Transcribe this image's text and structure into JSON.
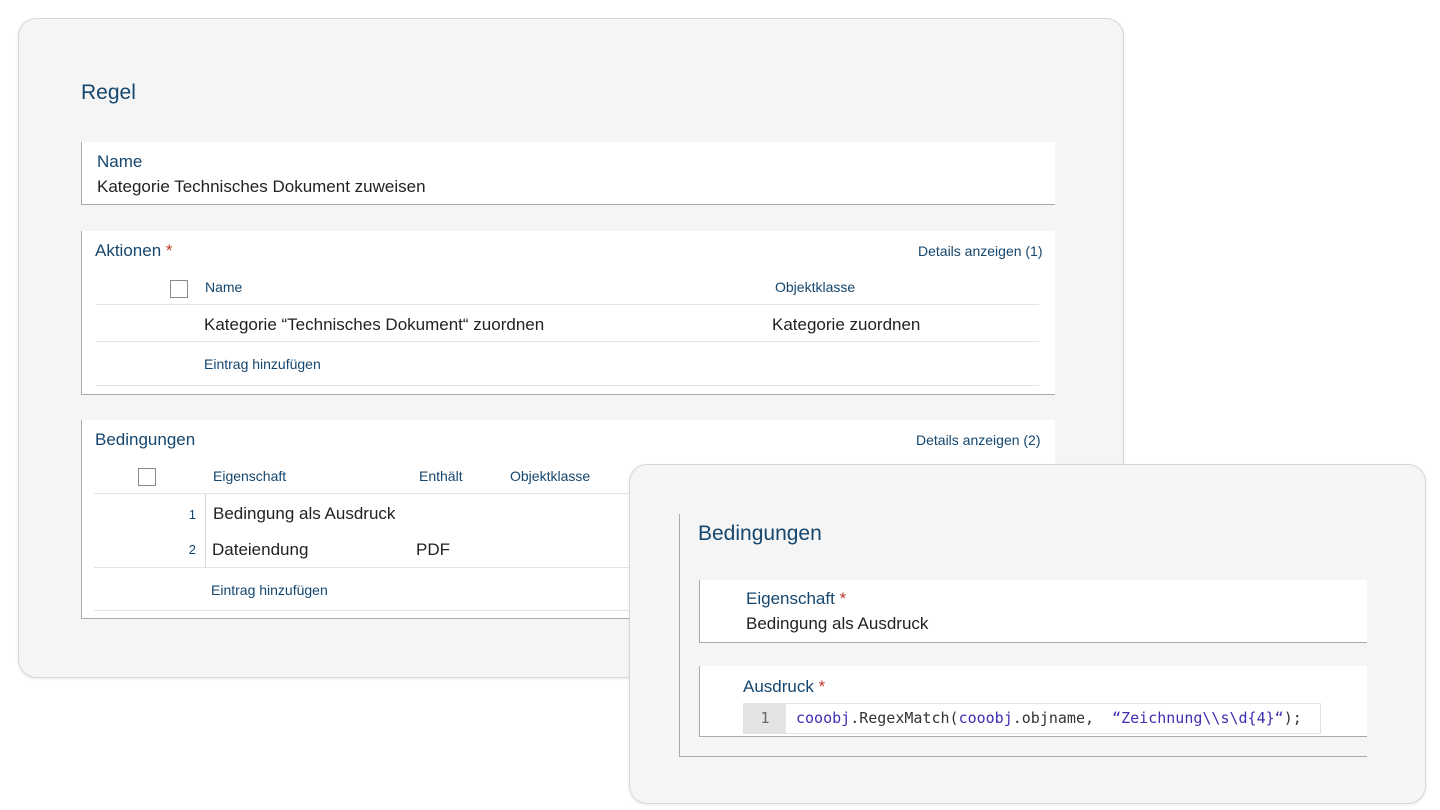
{
  "rule": {
    "title": "Regel",
    "name_label": "Name",
    "name_value": "Kategorie Technisches Dokument zuweisen"
  },
  "actions": {
    "title": "Aktionen",
    "required": "*",
    "details_link": "Details anzeigen (1)",
    "columns": [
      "Name",
      "Objektklasse"
    ],
    "rows": [
      {
        "name": "Kategorie “Technisches Dokument“ zuordnen",
        "objektklasse": "Kategorie zuordnen"
      }
    ],
    "add_entry": "Eintrag hinzufügen"
  },
  "conditions": {
    "title": "Bedingungen",
    "details_link": "Details anzeigen (2)",
    "columns": [
      "Eigenschaft",
      "Enthält",
      "Objektklasse"
    ],
    "rows": [
      {
        "num": "1",
        "eigenschaft": "Bedingung als Ausdruck",
        "enthaelt": ""
      },
      {
        "num": "2",
        "eigenschaft": "Dateiendung",
        "enthaelt": "PDF"
      }
    ],
    "add_entry": "Eintrag hinzufügen"
  },
  "condition_detail": {
    "title": "Bedingungen",
    "property_label": "Eigenschaft",
    "property_required": "*",
    "property_value": "Bedingung als Ausdruck",
    "expression_label": "Ausdruck",
    "expression_required": "*",
    "code_line_number": "1",
    "code": {
      "obj1": "cooobj",
      "mid1": ".RegexMatch(",
      "obj2": "cooobj",
      "mid2": ".objname,  ",
      "str": "“Zeichnung\\\\s\\d{4}“",
      "end": ");"
    }
  },
  "colors": {
    "accent": "#14466e",
    "required": "#c0392b",
    "panel_bg": "#f5f5f5",
    "code_token": "#3d2fb3"
  }
}
